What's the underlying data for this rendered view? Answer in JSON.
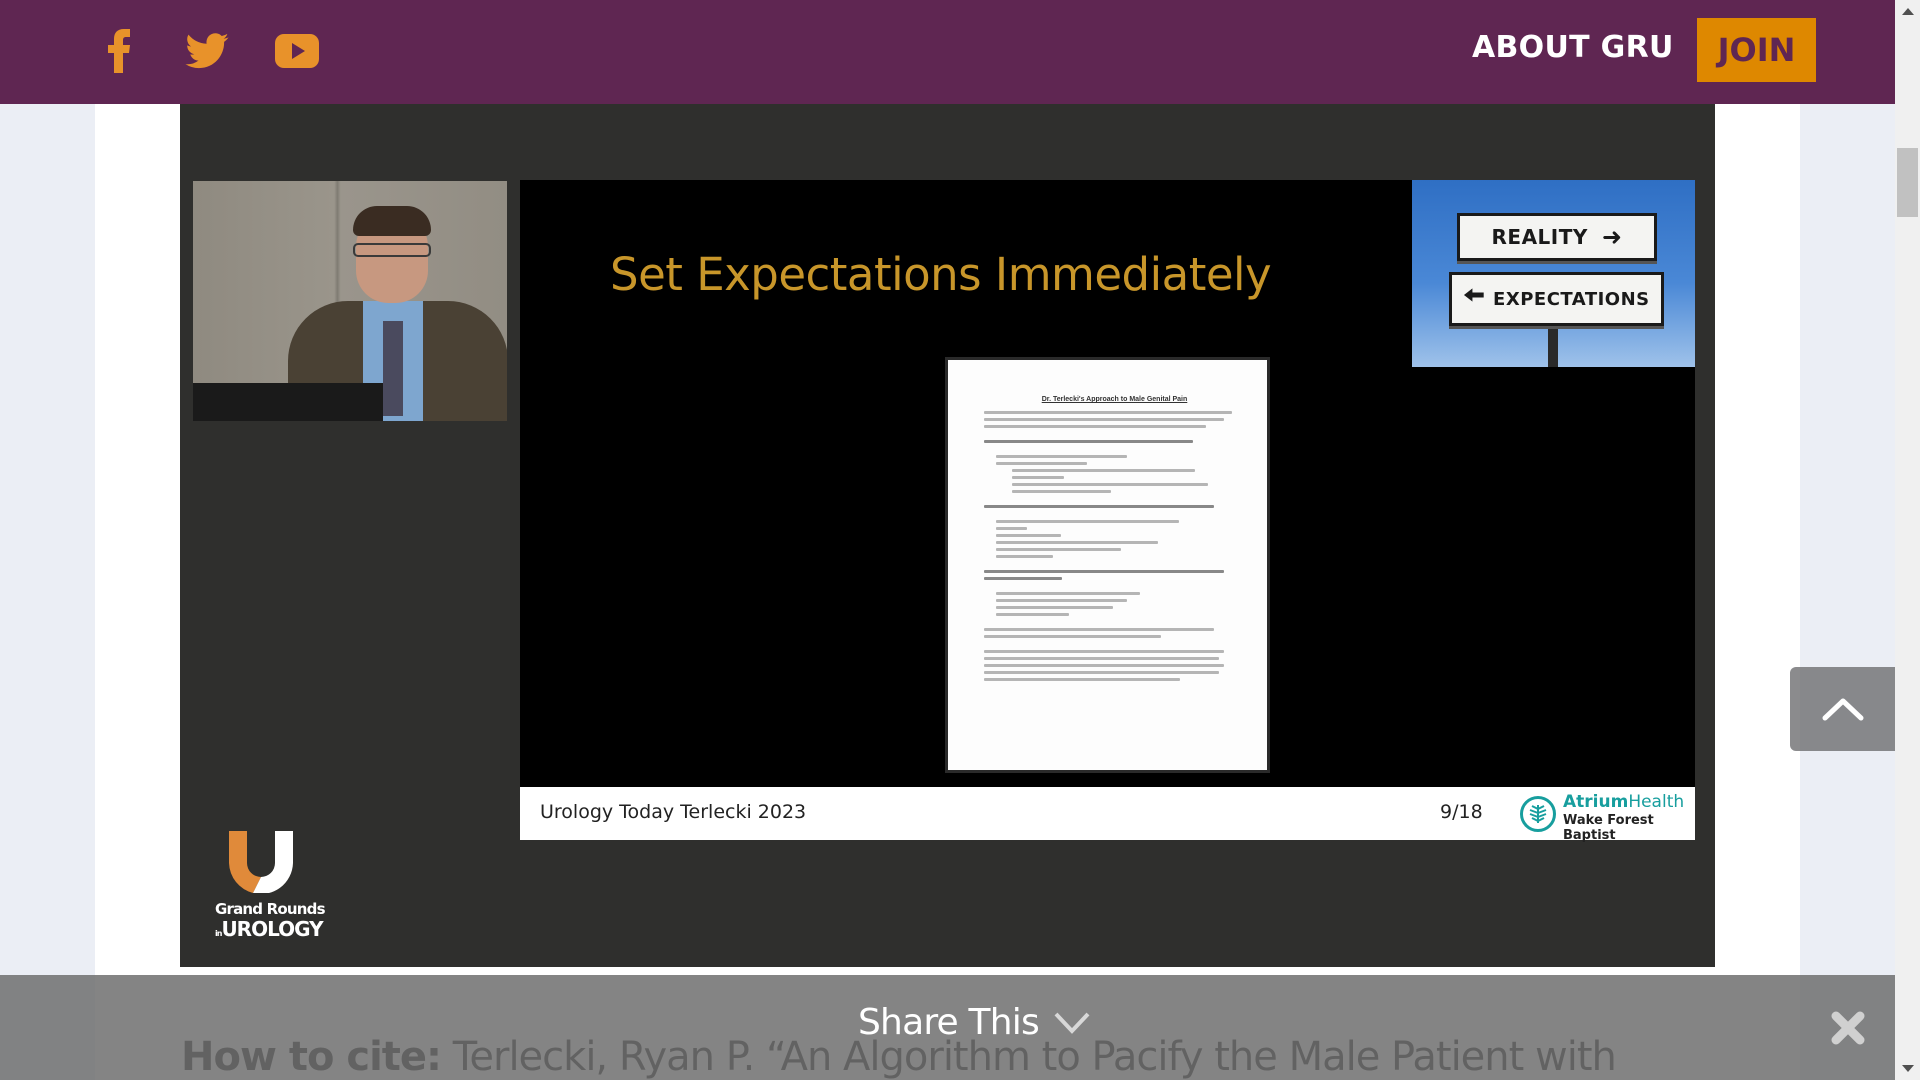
{
  "header": {
    "social": [
      {
        "name": "facebook",
        "icon": "facebook-icon"
      },
      {
        "name": "twitter",
        "icon": "twitter-icon"
      },
      {
        "name": "youtube",
        "icon": "youtube-icon"
      }
    ],
    "nav_about": "ABOUT GRU",
    "join_label": "JOIN",
    "colors": {
      "bar": "#5f2652",
      "accent": "#de8800"
    }
  },
  "video": {
    "slide": {
      "title": "Set Expectations Immediately",
      "sign_top": "REALITY",
      "sign_bottom": "EXPECTATIONS",
      "document": {
        "title": "Dr. Terlecki's Approach to Male Genital Pain"
      },
      "footer_text": "Urology Today Terlecki 2023",
      "page": "9/18",
      "sponsor_name_bold": "Atrium",
      "sponsor_name_rest": "Health",
      "sponsor_sub": "Wake Forest Baptist"
    },
    "logo": {
      "line1": "Grand Rounds",
      "line2_small": "in",
      "line2": "UROLOGY"
    }
  },
  "citation": {
    "label": "How to cite:",
    "text": " Terlecki, Ryan P. “An Algorithm to Pacify the Male Patient with"
  },
  "share": {
    "label": "Share This"
  }
}
